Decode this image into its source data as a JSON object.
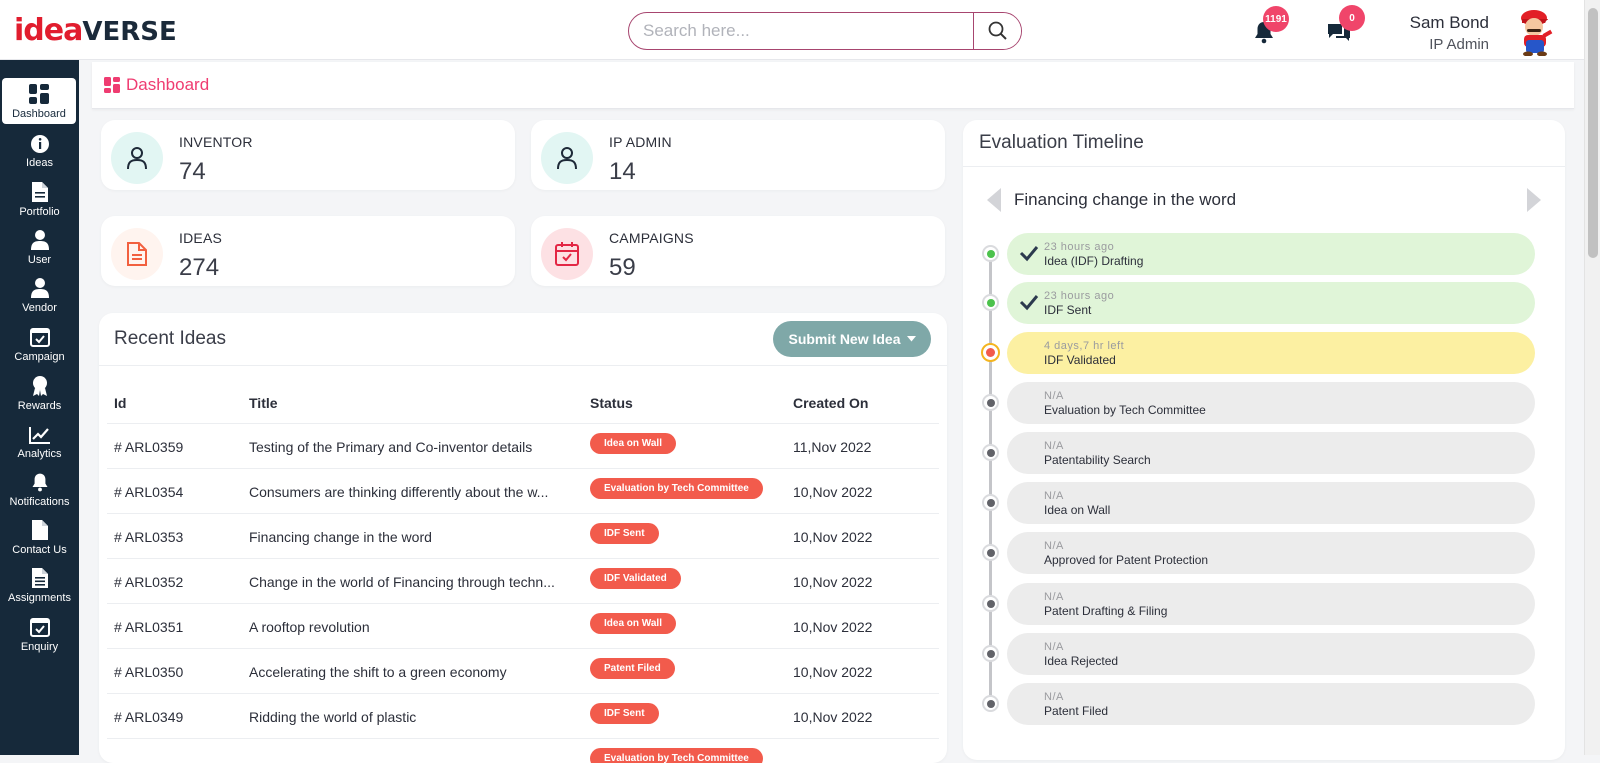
{
  "header": {
    "logo_idea": "idea",
    "logo_verse": "VERSE",
    "search_placeholder": "Search here...",
    "notifications_count": "1191",
    "messages_count": "0",
    "user_name": "Sam Bond",
    "user_role": "IP Admin"
  },
  "sidebar": {
    "items": [
      {
        "label": "Dashboard",
        "icon": "dashboard-icon"
      },
      {
        "label": "Ideas",
        "icon": "info-icon"
      },
      {
        "label": "Portfolio",
        "icon": "document-icon"
      },
      {
        "label": "User",
        "icon": "user-icon"
      },
      {
        "label": "Vendor",
        "icon": "user-icon"
      },
      {
        "label": "Campaign",
        "icon": "calendar-check-icon"
      },
      {
        "label": "Rewards",
        "icon": "award-icon"
      },
      {
        "label": "Analytics",
        "icon": "chart-line-icon"
      },
      {
        "label": "Notifications",
        "icon": "bell-icon"
      },
      {
        "label": "Contact Us",
        "icon": "document-icon"
      },
      {
        "label": "Assignments",
        "icon": "document-lines-icon"
      },
      {
        "label": "Enquiry",
        "icon": "calendar-check-icon"
      }
    ]
  },
  "breadcrumb": {
    "title": "Dashboard"
  },
  "stats": [
    {
      "label": "INVENTOR",
      "value": "74"
    },
    {
      "label": "IP ADMIN",
      "value": "14"
    },
    {
      "label": "IDEAS",
      "value": "274"
    },
    {
      "label": "CAMPAIGNS",
      "value": "59"
    }
  ],
  "recent": {
    "title": "Recent Ideas",
    "submit_label": "Submit New Idea",
    "columns": [
      "Id",
      "Title",
      "Status",
      "Created On"
    ],
    "rows": [
      {
        "id": "# ARL0359",
        "title": "Testing of the Primary and Co-inventor details",
        "status": "Idea on Wall",
        "date": "11,Nov 2022"
      },
      {
        "id": "# ARL0354",
        "title": "Consumers are thinking differently about the w...",
        "status": "Evaluation by Tech Committee",
        "date": "10,Nov 2022"
      },
      {
        "id": "# ARL0353",
        "title": "Financing change in the word",
        "status": "IDF Sent",
        "date": "10,Nov 2022"
      },
      {
        "id": "# ARL0352",
        "title": "Change in the world of Financing through techn...",
        "status": "IDF Validated",
        "date": "10,Nov 2022"
      },
      {
        "id": "# ARL0351",
        "title": "A rooftop revolution",
        "status": "Idea on Wall",
        "date": "10,Nov 2022"
      },
      {
        "id": "# ARL0350",
        "title": "Accelerating the shift to a green economy",
        "status": "Patent Filed",
        "date": "10,Nov 2022"
      },
      {
        "id": "# ARL0349",
        "title": "Ridding the world of plastic",
        "status": "IDF Sent",
        "date": "10,Nov 2022"
      },
      {
        "id": "",
        "title": "",
        "status": "Evaluation by Tech Committee",
        "date": ""
      }
    ]
  },
  "timeline": {
    "title": "Evaluation Timeline",
    "idea_title": "Financing change in the word",
    "steps": [
      {
        "time": "23 hours ago",
        "name": "Idea (IDF) Drafting",
        "state": "done"
      },
      {
        "time": "23 hours ago",
        "name": "IDF Sent",
        "state": "done"
      },
      {
        "time": "4 days,7 hr left",
        "name": "IDF Validated",
        "state": "current"
      },
      {
        "time": "N/A",
        "name": "Evaluation by Tech Committee",
        "state": "pending"
      },
      {
        "time": "N/A",
        "name": "Patentability Search",
        "state": "pending"
      },
      {
        "time": "N/A",
        "name": "Idea on Wall",
        "state": "pending"
      },
      {
        "time": "N/A",
        "name": "Approved for Patent Protection",
        "state": "pending"
      },
      {
        "time": "N/A",
        "name": "Patent Drafting & Filing",
        "state": "pending"
      },
      {
        "time": "N/A",
        "name": "Idea Rejected",
        "state": "pending"
      },
      {
        "time": "N/A",
        "name": "Patent Filed",
        "state": "pending"
      }
    ]
  },
  "colors": {
    "brand_red": "#e11d2e",
    "brand_navy": "#16293a",
    "accent_pink": "#ef3c71",
    "status_red": "#f25b4c",
    "done_green": "#e0f5d8",
    "current_yellow": "#fcf0a2"
  }
}
